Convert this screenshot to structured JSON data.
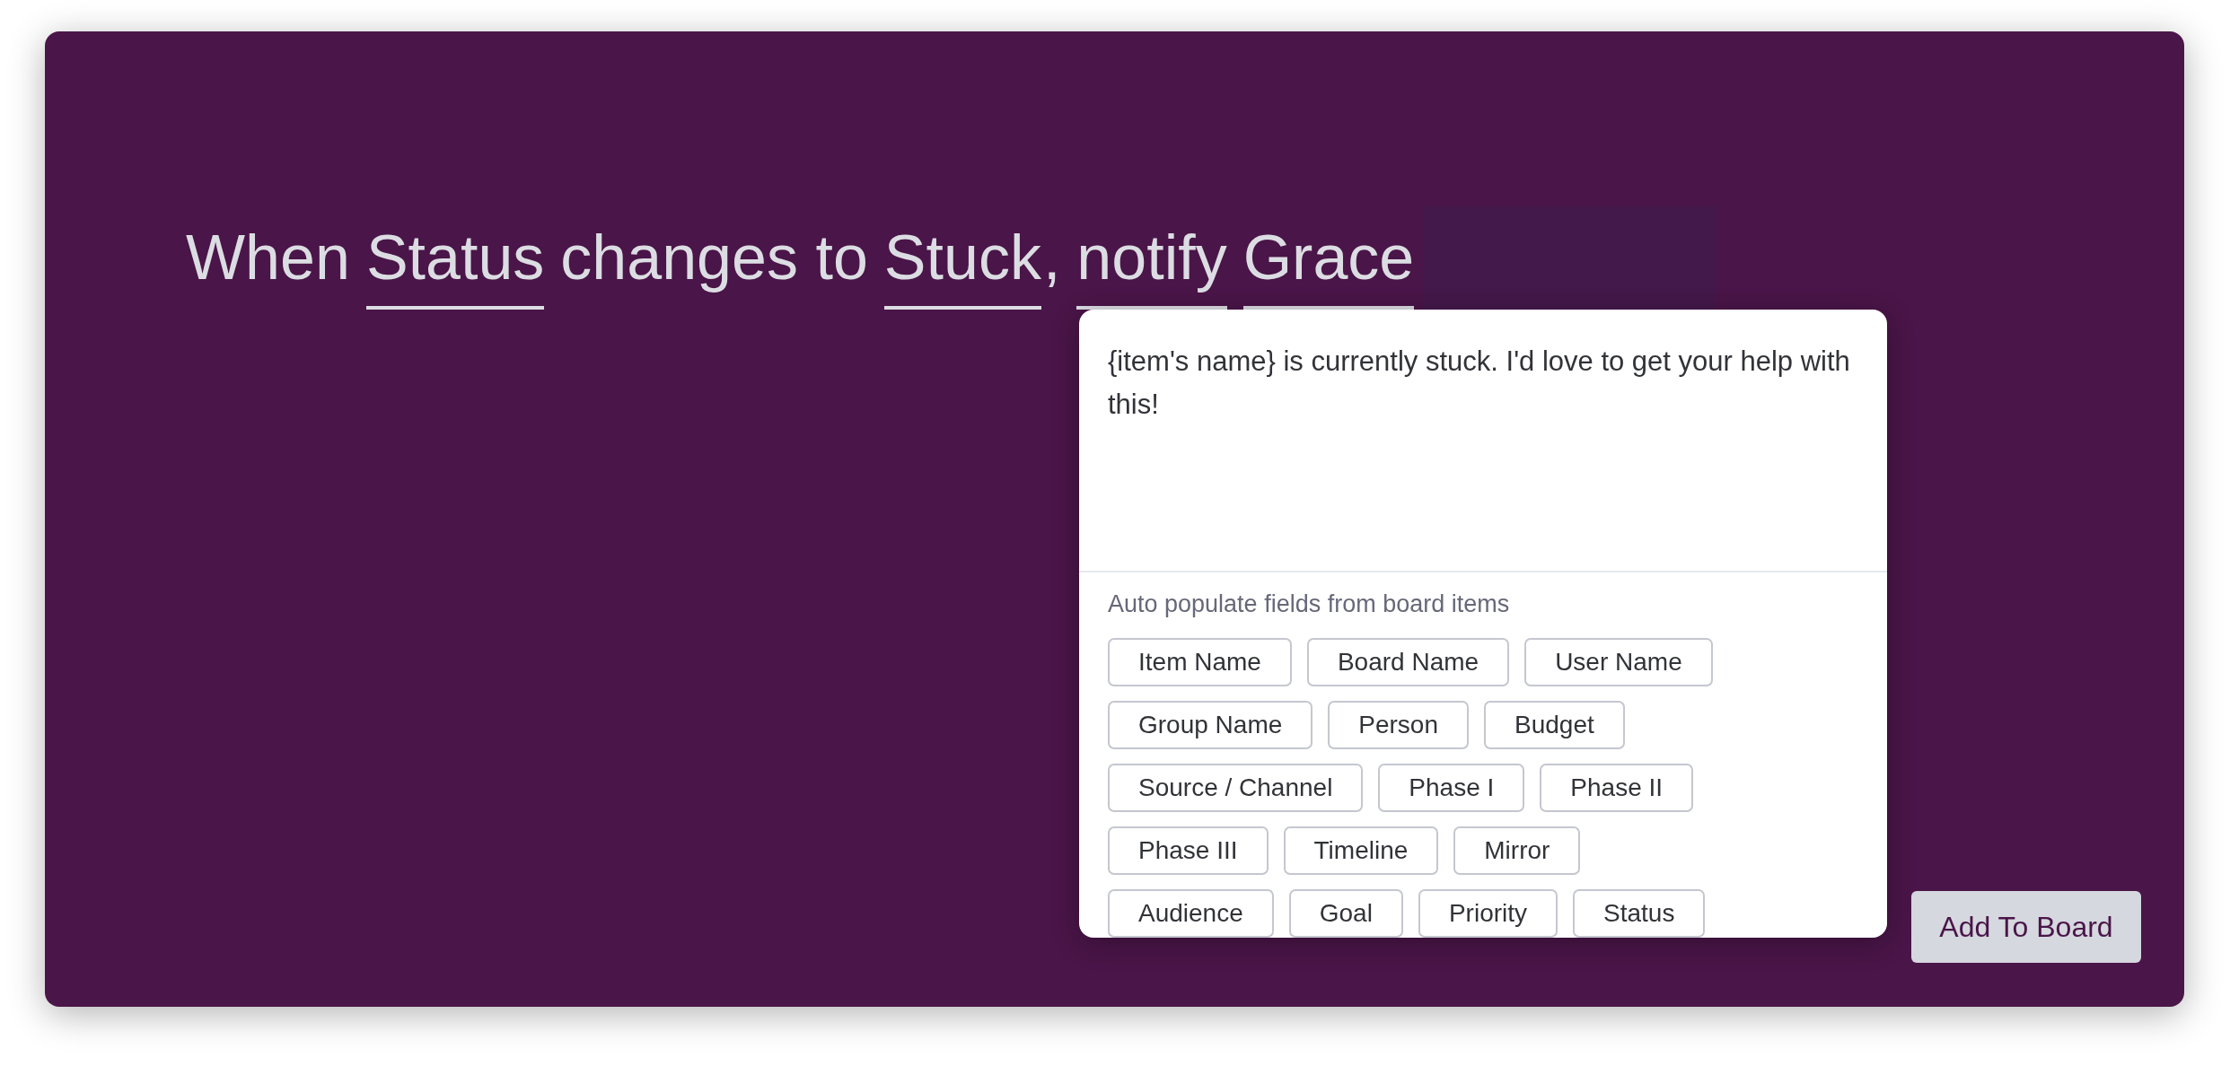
{
  "sentence": [
    {
      "text": "When",
      "kind": "plain"
    },
    {
      "text": "Status",
      "kind": "field"
    },
    {
      "text": "changes to",
      "kind": "plain"
    },
    {
      "text": "Stuck",
      "kind": "field"
    },
    {
      "text": ",",
      "kind": "punct"
    },
    {
      "text": "notify",
      "kind": "field"
    },
    {
      "text": "Grace",
      "kind": "field"
    }
  ],
  "message_popup": {
    "message": "{item's name} is currently stuck. I'd love to get your help with this!",
    "fields_label": "Auto populate fields from board items",
    "fields": [
      "Item Name",
      "Board Name",
      "User Name",
      "Group Name",
      "Person",
      "Budget",
      "Source / Channel",
      "Phase I",
      "Phase II",
      "Phase III",
      "Timeline",
      "Mirror",
      "Audience",
      "Goal",
      "Priority",
      "Status"
    ]
  },
  "add_button": "Add To Board"
}
